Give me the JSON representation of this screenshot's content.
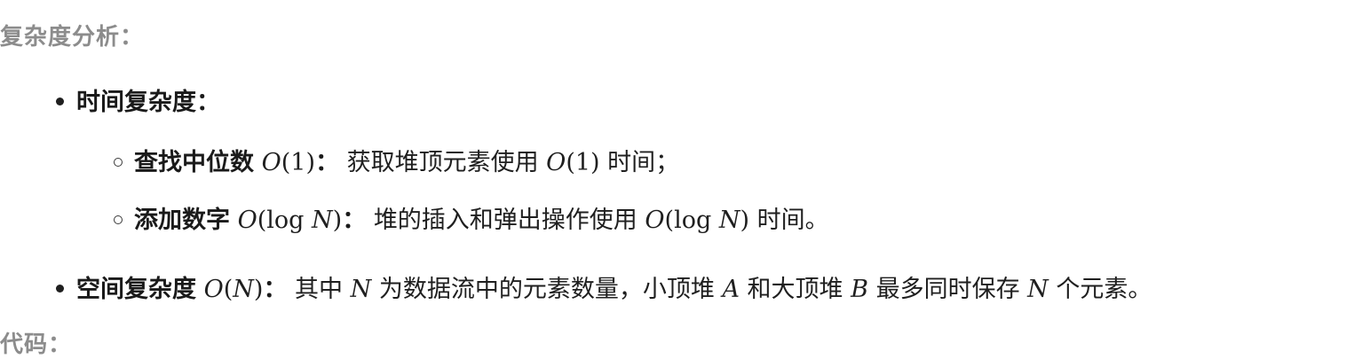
{
  "heading_complexity": "复杂度分析：",
  "time": {
    "label": "时间复杂度："
  },
  "find_median": {
    "label": "查找中位数",
    "math_open": "O",
    "math_arg": "(1)",
    "sep": "：",
    "desc": "获取堆顶元素使用",
    "desc_math_open": "O",
    "desc_math_arg": "(1)",
    "tail": "时间；"
  },
  "add_num": {
    "label": "添加数字",
    "math_open": "O",
    "math_arg_prefix": "(log",
    "math_var": "N",
    "math_close": ")",
    "sep": "：",
    "desc": "堆的插入和弹出操作使用",
    "tail": "时间。"
  },
  "space": {
    "label": "空间复杂度",
    "math_open": "O",
    "math_arg_open": "(",
    "math_var": "N",
    "math_close": ")",
    "sep": "：",
    "desc_1": "其中",
    "var_n": "N",
    "desc_2": "为数据流中的元素数量，小顶堆",
    "var_a": "A",
    "desc_3": "和大顶堆",
    "var_b": "B",
    "desc_4": "最多同时保存",
    "desc_5": "个元素。"
  },
  "heading_code": "代码："
}
